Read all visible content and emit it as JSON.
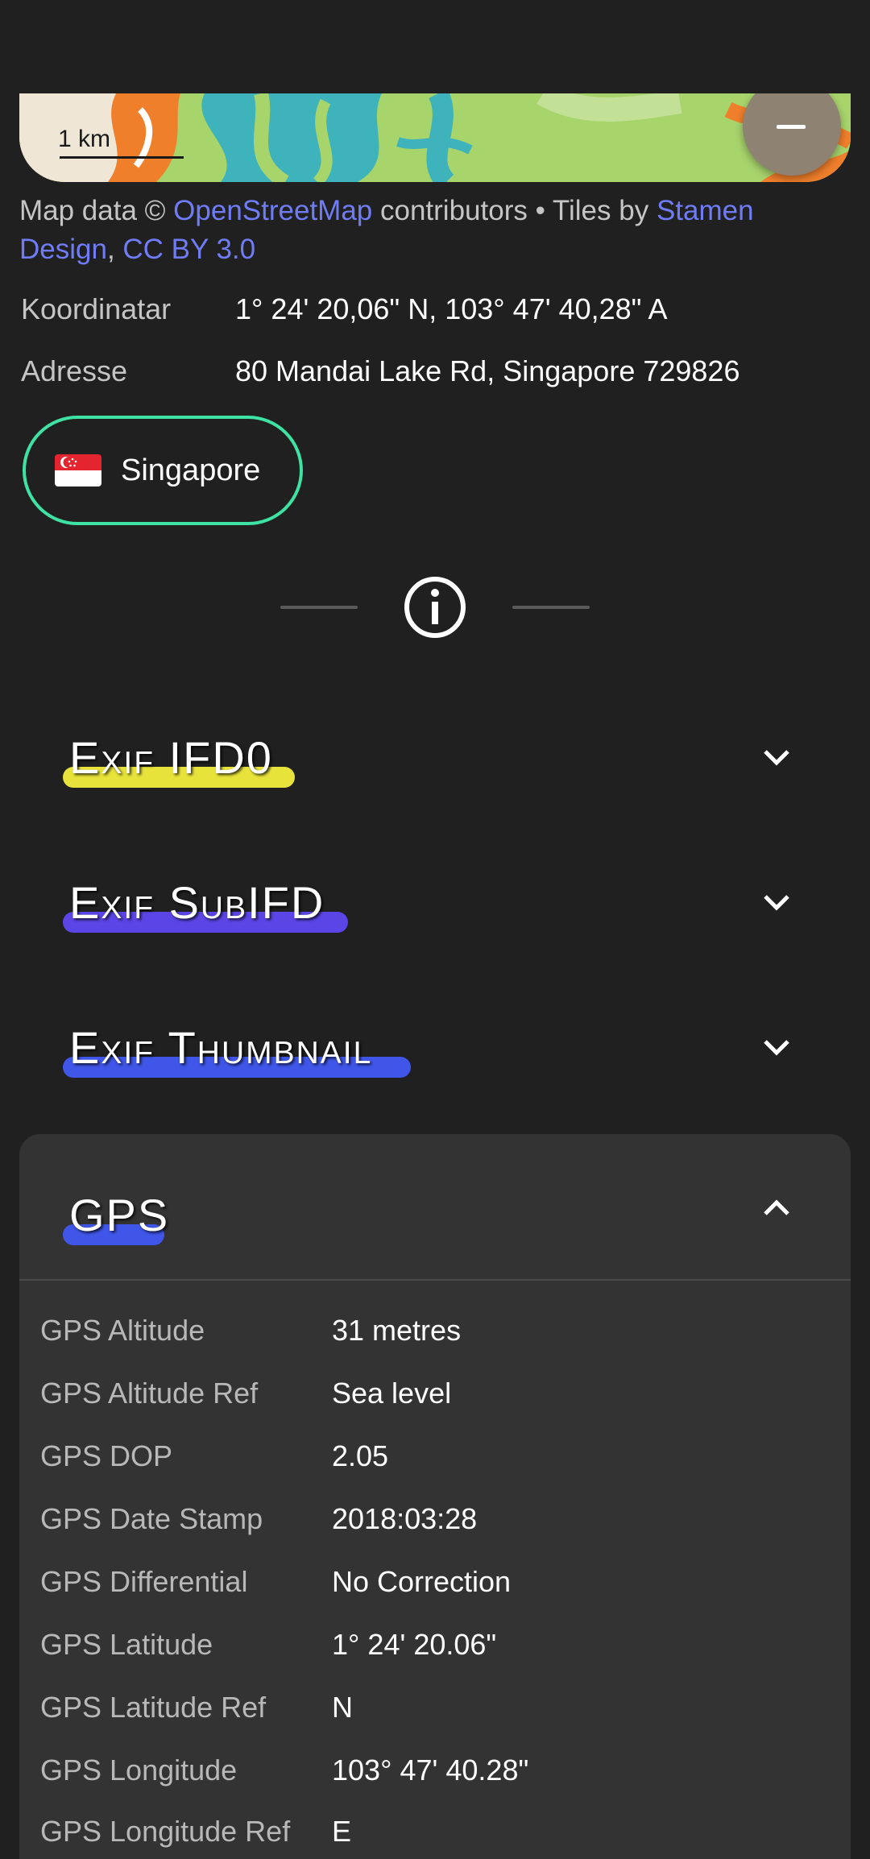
{
  "map": {
    "scale_label": "1 km"
  },
  "attribution": {
    "prefix": "Map data © ",
    "osm_link": "OpenStreetMap",
    "middle": " contributors • Tiles by ",
    "stamen_link": "Stamen Design",
    "separator": ", ",
    "license_link": "CC BY 3.0"
  },
  "location": {
    "coordinates_label": "Koordinatar",
    "coordinates_value": "1° 24' 20,06\" N, 103° 47' 40,28\" A",
    "address_label": "Adresse",
    "address_value": "80 Mandai Lake Rd, Singapore 729826"
  },
  "country_chip": {
    "flag_icon": "singapore-flag-icon",
    "label": "Singapore"
  },
  "sections": [
    {
      "title": "Exif IFD0",
      "highlight_color": "#e8e33a",
      "expanded": false
    },
    {
      "title": "Exif SubIFD",
      "highlight_color": "#5b45e6",
      "expanded": false
    },
    {
      "title": "Exif Thumbnail",
      "highlight_color": "#3f56e8",
      "expanded": false
    },
    {
      "title": "GPS",
      "highlight_color": "#3f56e8",
      "expanded": true
    }
  ],
  "gps_rows": [
    {
      "label": "GPS Altitude",
      "value": "31 metres"
    },
    {
      "label": "GPS Altitude Ref",
      "value": "Sea level"
    },
    {
      "label": "GPS DOP",
      "value": "2.05"
    },
    {
      "label": "GPS Date Stamp",
      "value": "2018:03:28"
    },
    {
      "label": "GPS Differential",
      "value": "No Correction"
    },
    {
      "label": "GPS Latitude",
      "value": "1° 24' 20.06\""
    },
    {
      "label": "GPS Latitude Ref",
      "value": "N"
    },
    {
      "label": "GPS Longitude",
      "value": "103° 47' 40.28\""
    },
    {
      "label": "GPS Longitude Ref",
      "value": "E"
    }
  ],
  "colors": {
    "background": "#202020",
    "card": "#333333",
    "accent_chip_border": "#3ee3a4",
    "link": "#6f7cf5"
  }
}
